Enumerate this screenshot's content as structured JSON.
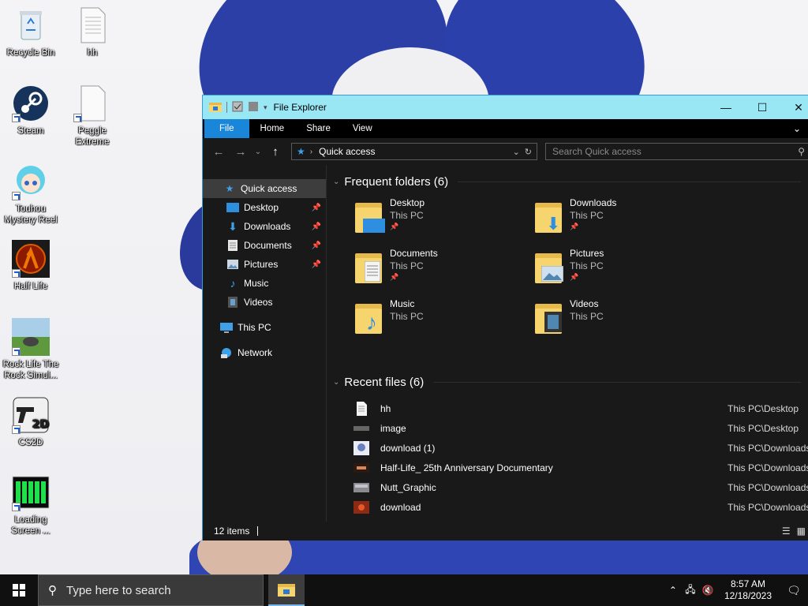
{
  "desktop": {
    "icons": [
      {
        "label": "Recycle Bin",
        "icon": "recycle-bin-icon"
      },
      {
        "label": "hh",
        "icon": "text-file-icon"
      },
      {
        "label": "Steam",
        "icon": "steam-icon"
      },
      {
        "label": "Peggle Extreme",
        "icon": "blank-file-icon"
      },
      {
        "label": "Touhou Mystery Reel",
        "icon": "touhou-icon"
      },
      {
        "label": "Half Life",
        "icon": "half-life-icon"
      },
      {
        "label": "Rock Life The Rock Simul...",
        "icon": "rock-life-icon"
      },
      {
        "label": "CS2D",
        "icon": "cs2d-icon"
      },
      {
        "label": "Loading Screen ...",
        "icon": "loading-screen-icon"
      }
    ]
  },
  "window": {
    "title": "File Explorer",
    "controls": {
      "minimize": "—",
      "maximize": "☐",
      "close": "✕"
    },
    "ribbon": {
      "file": "File",
      "home": "Home",
      "share": "Share",
      "view": "View"
    },
    "address": {
      "location": "Quick access",
      "search_placeholder": "Search Quick access"
    },
    "nav": {
      "quick_access": "Quick access",
      "items": [
        {
          "label": "Desktop",
          "pinned": true
        },
        {
          "label": "Downloads",
          "pinned": true
        },
        {
          "label": "Documents",
          "pinned": true
        },
        {
          "label": "Pictures",
          "pinned": true
        },
        {
          "label": "Music",
          "pinned": false
        },
        {
          "label": "Videos",
          "pinned": false
        }
      ],
      "this_pc": "This PC",
      "network": "Network"
    },
    "frequent": {
      "header": "Frequent folders (6)",
      "folders": [
        {
          "name": "Desktop",
          "location": "This PC",
          "pinned": true
        },
        {
          "name": "Downloads",
          "location": "This PC",
          "pinned": true
        },
        {
          "name": "Documents",
          "location": "This PC",
          "pinned": true
        },
        {
          "name": "Pictures",
          "location": "This PC",
          "pinned": true
        },
        {
          "name": "Music",
          "location": "This PC",
          "pinned": false
        },
        {
          "name": "Videos",
          "location": "This PC",
          "pinned": false
        }
      ]
    },
    "recent": {
      "header": "Recent files (6)",
      "files": [
        {
          "name": "hh",
          "path": "This PC\\Desktop"
        },
        {
          "name": "image",
          "path": "This PC\\Desktop"
        },
        {
          "name": "download (1)",
          "path": "This PC\\Downloads"
        },
        {
          "name": "Half-Life_ 25th Anniversary Documentary",
          "path": "This PC\\Downloads"
        },
        {
          "name": "Nutt_Graphic",
          "path": "This PC\\Downloads"
        },
        {
          "name": "download",
          "path": "This PC\\Downloads"
        }
      ]
    },
    "status": {
      "items": "12 items"
    }
  },
  "taskbar": {
    "search_placeholder": "Type here to search",
    "time": "8:57 AM",
    "date": "12/18/2023"
  },
  "colors": {
    "accent": "#1a86d9",
    "titlebar": "#99e6f5",
    "window_bg": "#191919"
  }
}
